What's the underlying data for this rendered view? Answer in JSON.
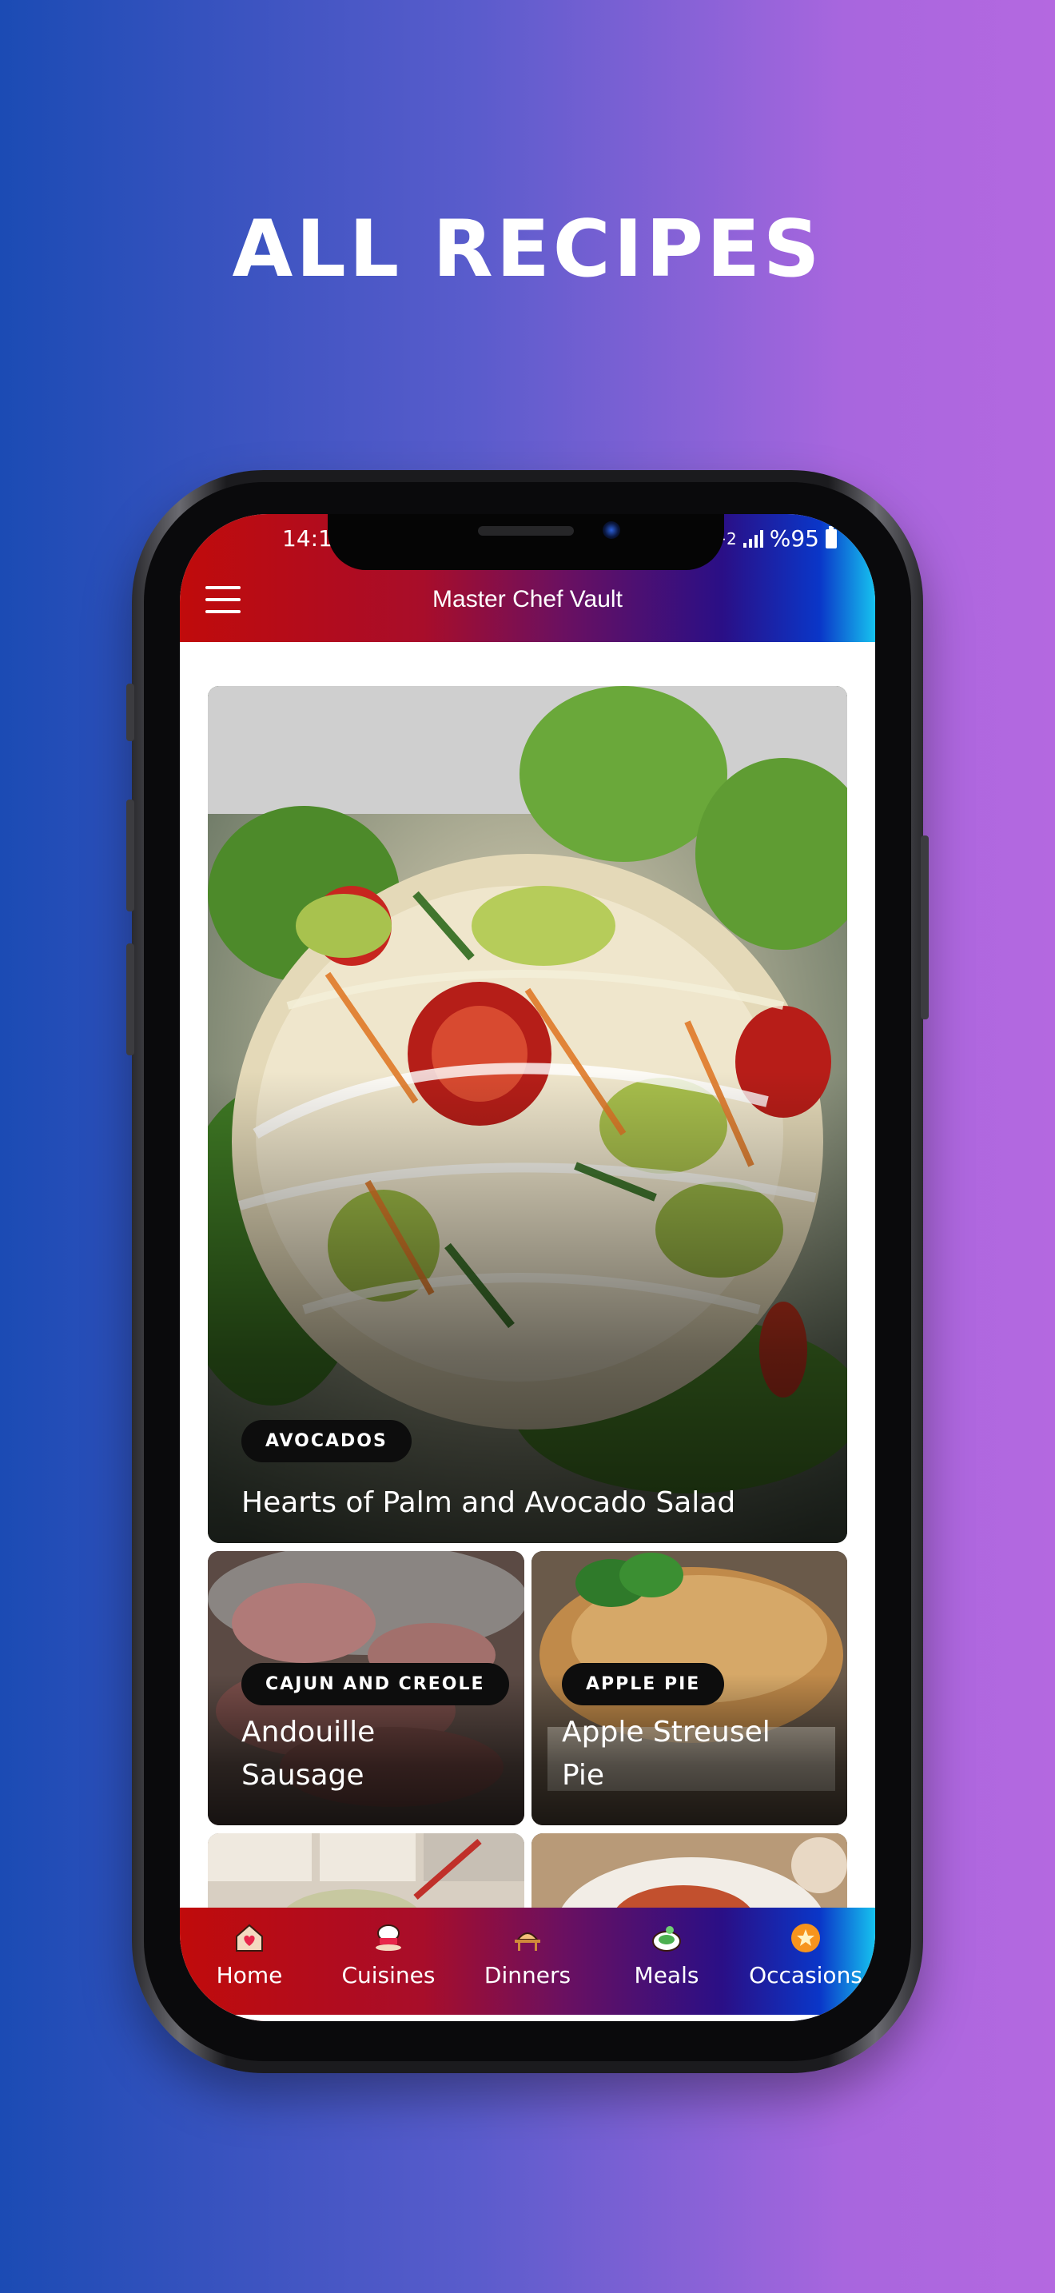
{
  "headline": "ALL RECIPES",
  "status_bar": {
    "time": "14:1",
    "network": "+2",
    "battery": "%95"
  },
  "app_bar": {
    "title": "Master Chef Vault",
    "menu_icon": "hamburger-menu-icon"
  },
  "featured": {
    "tag": "AVOCADOS",
    "title": "Hearts of Palm and Avocado Salad"
  },
  "recipes": [
    {
      "tag": "CAJUN AND CREOLE",
      "title_line1": "Andouille",
      "title_line2": "Sausage"
    },
    {
      "tag": "APPLE PIE",
      "title_line1": "Apple Streusel",
      "title_line2": "Pie"
    },
    {
      "tag": "",
      "title_line1": "",
      "title_line2": ""
    },
    {
      "tag": "",
      "title_line1": "",
      "title_line2": ""
    }
  ],
  "bottom_nav": [
    {
      "label": "Home",
      "icon": "home-heart-icon"
    },
    {
      "label": "Cuisines",
      "icon": "chef-hat-icon"
    },
    {
      "label": "Dinners",
      "icon": "dinner-table-icon"
    },
    {
      "label": "Meals",
      "icon": "meal-plate-icon"
    },
    {
      "label": "Occasions",
      "icon": "occasions-badge-icon"
    }
  ]
}
